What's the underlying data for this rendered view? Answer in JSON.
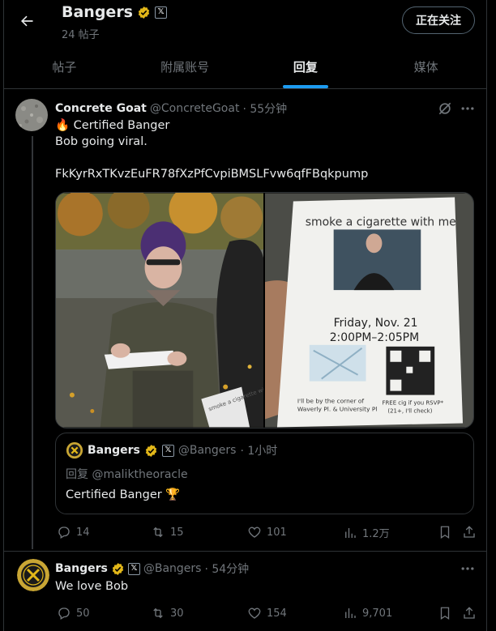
{
  "header": {
    "name": "Bangers",
    "post_count": "24 帖子",
    "follow_label": "正在关注"
  },
  "tabs": [
    {
      "label": "帖子",
      "active": false
    },
    {
      "label": "附属账号",
      "active": false
    },
    {
      "label": "回复",
      "active": true
    },
    {
      "label": "媒体",
      "active": false
    }
  ],
  "post1": {
    "name": "Concrete Goat",
    "handle": "@ConcreteGoat",
    "time": "· 55分钟",
    "line1_emoji": "🔥",
    "line1": "Certified Banger",
    "line2": "Bob going viral.",
    "line3": "FkKyrRxTKvzEuFR78fXzPfCvpiBMSLFvw6qfFBqkpump",
    "flyer": {
      "title": "smoke a cigarette with me",
      "date": "Friday, Nov. 21",
      "time": "2:00PM–2:05PM",
      "left_note_1": "I'll be by the corner of",
      "left_note_2": "Waverly Pl. & University Pl",
      "right_note_1": "FREE cig if you RSVP*",
      "right_note_2": "(21+, I'll check)",
      "held_flyer_text": "smoke a cigarette with me"
    },
    "quote": {
      "name": "Bangers",
      "handle": "@Bangers",
      "time": "· 1小时",
      "reply_to": "回复 @maliktheoracle",
      "text": "Certified Banger",
      "emoji": "🏆"
    },
    "stats": {
      "replies": "14",
      "reposts": "15",
      "likes": "101",
      "views": "1.2万"
    }
  },
  "post2": {
    "name": "Bangers",
    "handle": "@Bangers",
    "time": "· 54分钟",
    "text": "We love Bob",
    "stats": {
      "replies": "50",
      "reposts": "30",
      "likes": "154",
      "views": "9,701"
    }
  },
  "colors": {
    "accent": "#1d9bf0",
    "muted": "#71767b",
    "border": "#2f3336",
    "gold": "#e2b719"
  },
  "icons": [
    "back-arrow-icon",
    "verified-gold-icon",
    "x-affiliate-icon",
    "grok-icon",
    "more-icon",
    "reply-icon",
    "repost-icon",
    "like-icon",
    "views-icon",
    "bookmark-icon",
    "share-icon"
  ]
}
